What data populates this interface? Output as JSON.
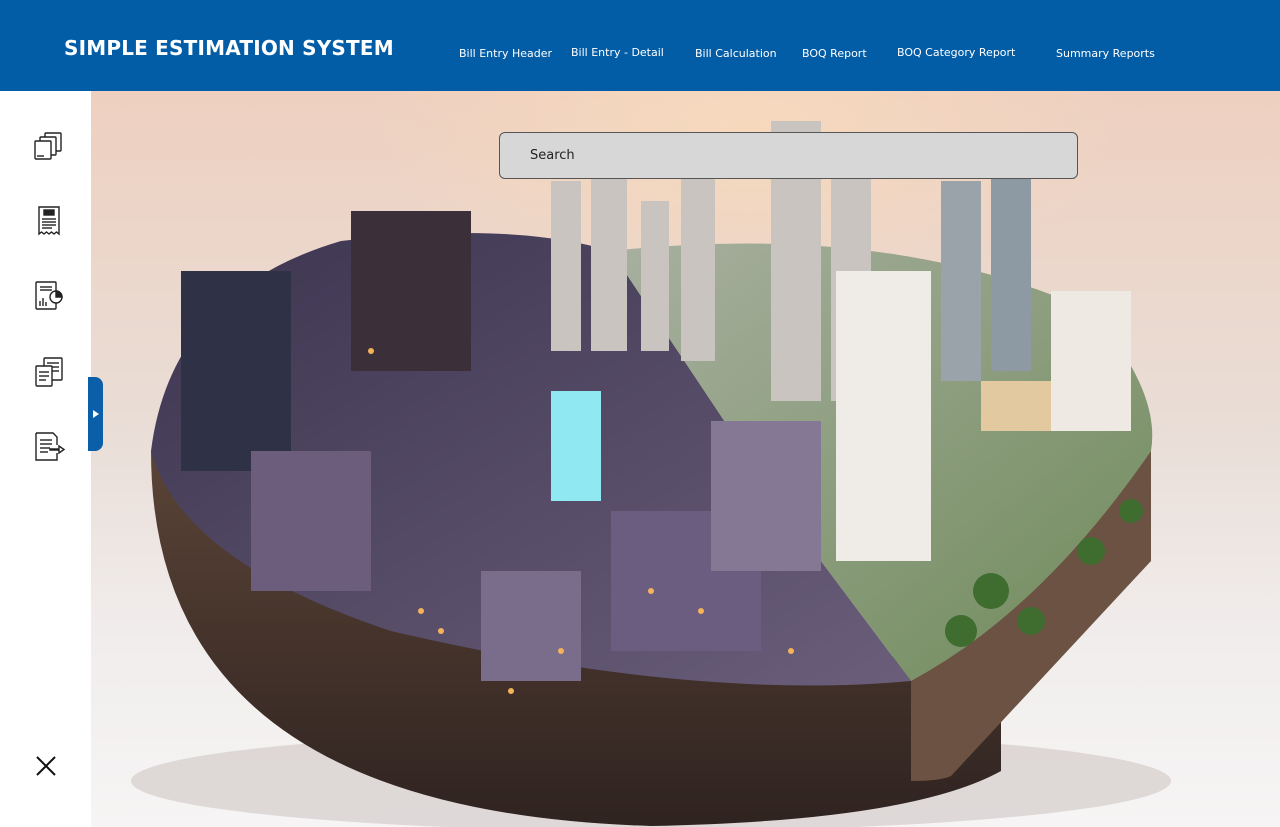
{
  "header": {
    "title": "SIMPLE ESTIMATION SYSTEM",
    "nav": [
      {
        "label": "Bill Entry Header"
      },
      {
        "label": "Bill Entry - Detail"
      },
      {
        "label": "Bill Calculation"
      },
      {
        "label": "BOQ Report"
      },
      {
        "label": "BOQ Category Report"
      },
      {
        "label": "Summary Reports"
      }
    ]
  },
  "sidebar": {
    "items": [
      {
        "icon": "documents-stack-icon"
      },
      {
        "icon": "bill-receipt-icon"
      },
      {
        "icon": "report-chart-icon"
      },
      {
        "icon": "report-copy-icon"
      },
      {
        "icon": "document-export-icon"
      }
    ],
    "close_icon": "close-icon",
    "toggle_icon": "play-arrow-icon"
  },
  "search": {
    "placeholder": "Search",
    "value": ""
  },
  "hero": {
    "image": "city-island-illustration"
  },
  "colors": {
    "header_bg": "#035da6",
    "toggle_tab": "#0a5fa8",
    "search_bg": "#d7d7d7"
  }
}
